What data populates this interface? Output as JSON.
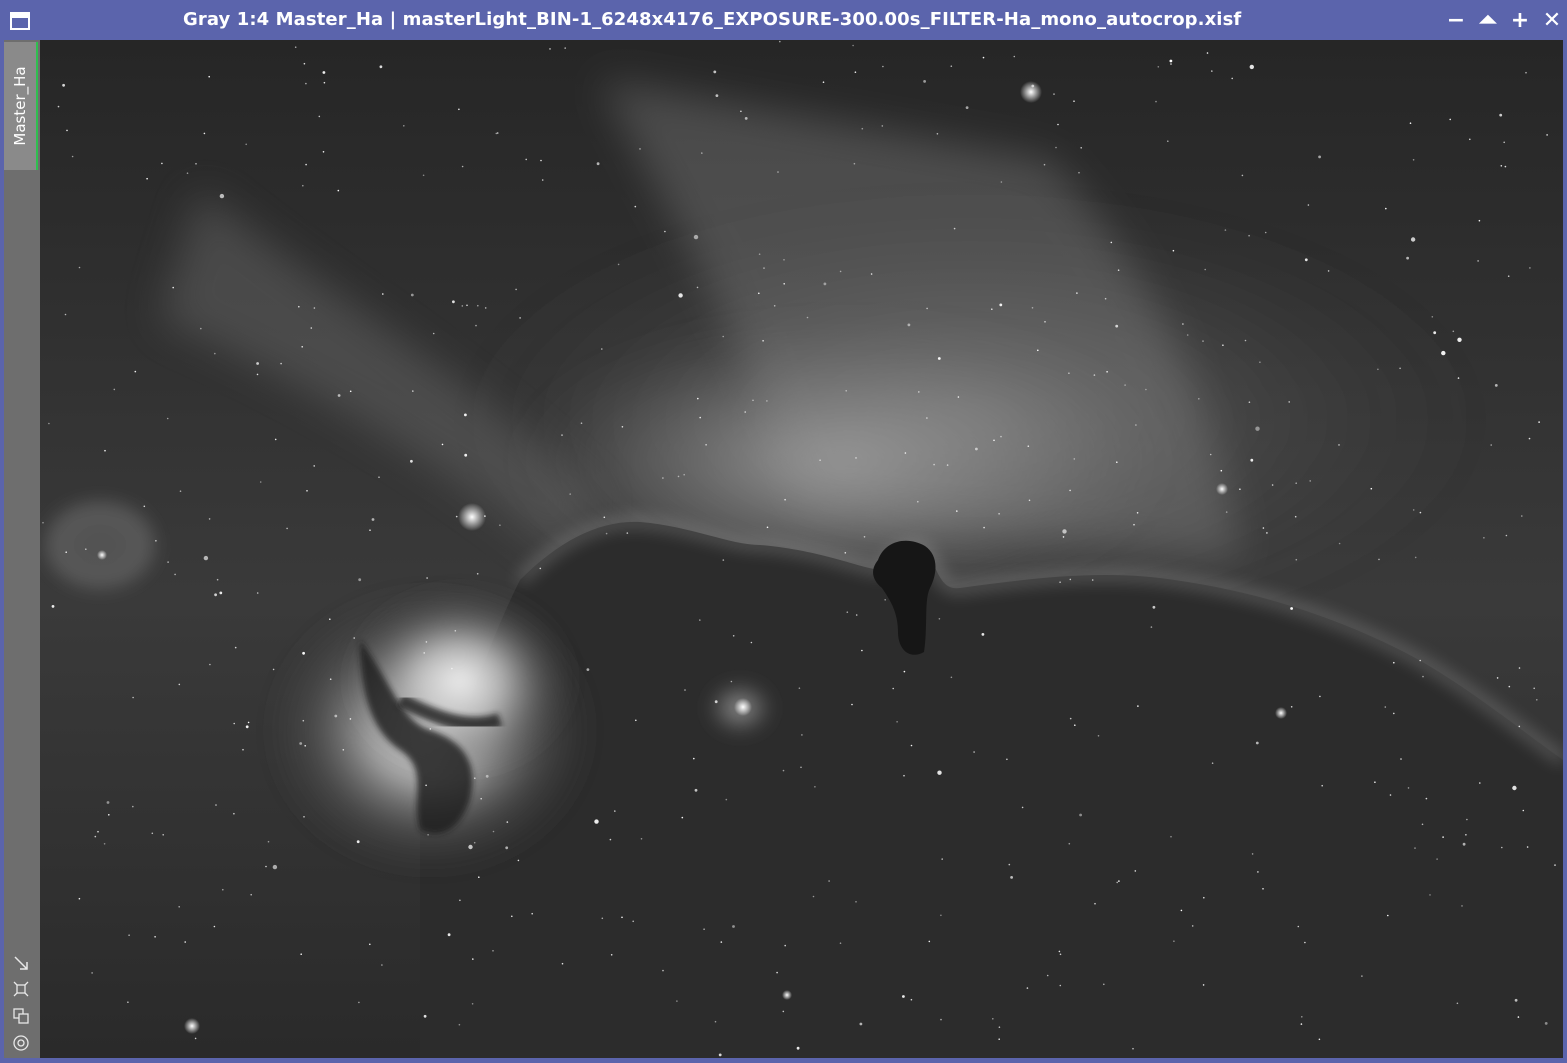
{
  "window": {
    "title": "Gray 1:4 Master_Ha | masterLight_BIN-1_6248x4176_EXPOSURE-300.00s_FILTER-Ha_mono_autocrop.xisf",
    "controls": {
      "minimize": "−",
      "shade": "⏶",
      "maximize": "+",
      "close": "✕"
    }
  },
  "sidebar": {
    "tab_label": "Master_Ha",
    "icons": [
      "resize-icon",
      "fit-view-icon",
      "clone-icon",
      "target-icon"
    ]
  },
  "colors": {
    "titlebar": "#5b64ac",
    "sidebar": "#6e6e6e",
    "tab_accent": "#2fbf4f"
  }
}
